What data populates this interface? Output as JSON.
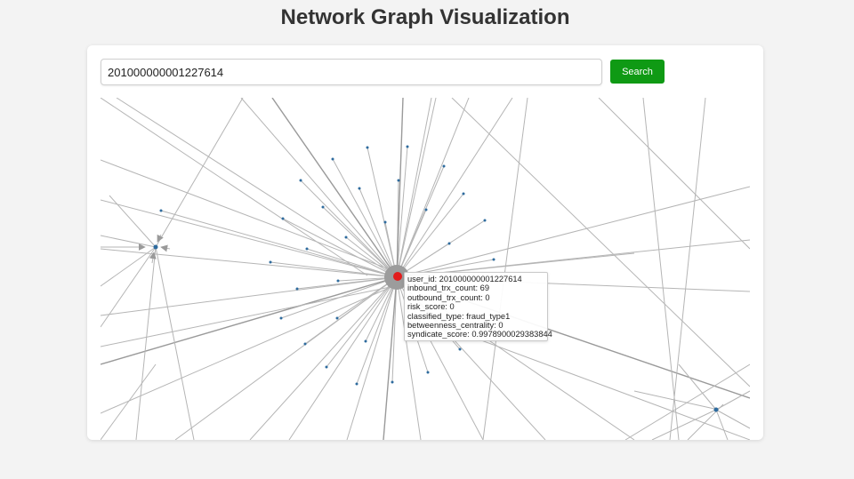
{
  "page": {
    "title": "Network Graph Visualization"
  },
  "search": {
    "value": "201000000001227614",
    "button_label": "Search"
  },
  "graph": {
    "edge_color": "#b5b5b5",
    "node_color": "#2e6b9e",
    "highlight_color": "#e31b1b",
    "tooltip": {
      "user_id": "user_id: 201000000001227614",
      "inbound": "inbound_trx_count: 69",
      "outbound": "outbound_trx_count: 0",
      "risk": "risk_score: 0",
      "classified": "classified_type: fraud_type1",
      "betweenness": "betweenness_centrality: 0",
      "syndicate": "syndicate_score: 0.9978900029383844"
    }
  }
}
